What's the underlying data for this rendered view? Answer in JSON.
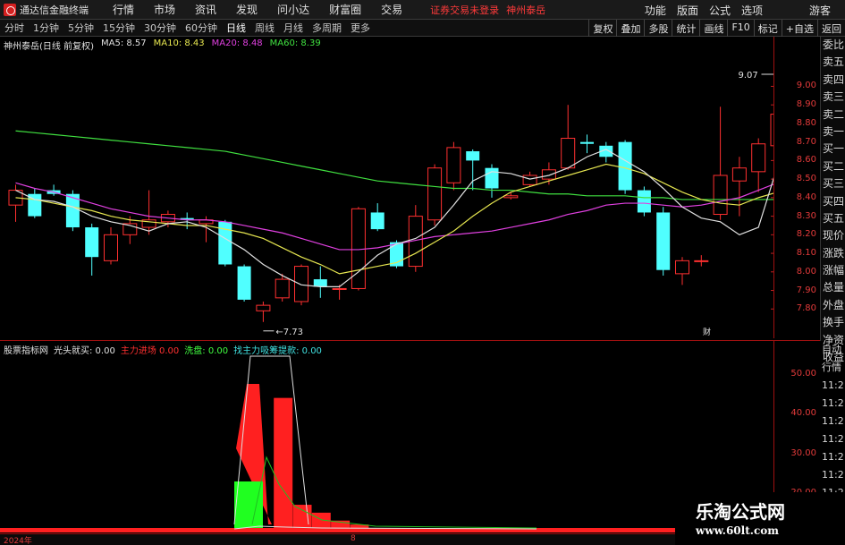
{
  "titlebar": {
    "app_title": "通达信金融终端",
    "menu": [
      "行情",
      "市场",
      "资讯",
      "发现",
      "问小达",
      "财富圈",
      "交易"
    ],
    "notice": "证券交易未登录",
    "stock_tag": "神州泰岳",
    "right_menu": [
      "功能",
      "版面",
      "公式",
      "选项"
    ],
    "guest": "游客"
  },
  "periodbar": {
    "periods": [
      "分时",
      "1分钟",
      "5分钟",
      "15分钟",
      "30分钟",
      "60分钟",
      "日线",
      "周线",
      "月线",
      "多周期",
      "更多"
    ],
    "active": "日线",
    "tools": [
      "复权",
      "叠加",
      "多股",
      "统计",
      "画线",
      "F10",
      "标记",
      "+自选",
      "返回"
    ]
  },
  "main_legend": {
    "stock": "神州泰岳(日线 前复权)",
    "ma5": "MA5: 8.57",
    "ma10": "MA10: 8.43",
    "ma20": "MA20: 8.48",
    "ma60": "MA60: 8.39"
  },
  "side_labels": [
    "委比",
    "卖五",
    "卖四",
    "卖三",
    "卖二",
    "卖一",
    "买一",
    "买二",
    "买三",
    "买四",
    "买五",
    "现价",
    "涨跌",
    "涨幅",
    "总量",
    "外盘",
    "换手",
    "净资",
    "收益"
  ],
  "sub_side_labels": [
    "自动",
    "行情",
    "11:2",
    "11:2",
    "11:2",
    "11:2",
    "11:2",
    "11:2",
    "11:2"
  ],
  "annotations": {
    "high": "9.07",
    "low": "7.73",
    "fin": "财"
  },
  "sub_legend": {
    "name": "股票指标网",
    "a": "光头就买: 0.00",
    "b": "主力进场 0.00",
    "c": "洗盘: 0.00",
    "d": "找主力吸筹提款: 0.00"
  },
  "bottombar": {
    "year": "2024年",
    "month": "8"
  },
  "watermark": {
    "line1": "乐淘公式网",
    "line2": "www.60lt.com"
  },
  "colors": {
    "up": "#ff3030",
    "down": "#50ffff",
    "axis": "#e23a3a",
    "ma5": "#e0e0e0",
    "ma10": "#e6e650",
    "ma20": "#e040e0",
    "ma60": "#40e040"
  },
  "chart_data": [
    {
      "type": "candlestick",
      "title": "神州泰岳(日线 前复权)",
      "ylim": [
        7.7,
        9.2
      ],
      "yticks": [
        9.0,
        8.9,
        8.8,
        8.7,
        8.6,
        8.5,
        8.4,
        8.3,
        8.2,
        8.1,
        8.0,
        7.9,
        7.8
      ],
      "candles": [
        {
          "o": 8.36,
          "c": 8.44,
          "h": 8.47,
          "l": 8.27
        },
        {
          "o": 8.42,
          "c": 8.3,
          "h": 8.45,
          "l": 8.29
        },
        {
          "o": 8.44,
          "c": 8.42,
          "h": 8.47,
          "l": 8.41
        },
        {
          "o": 8.42,
          "c": 8.24,
          "h": 8.44,
          "l": 8.22
        },
        {
          "o": 8.24,
          "c": 8.08,
          "h": 8.26,
          "l": 7.98
        },
        {
          "o": 8.06,
          "c": 8.2,
          "h": 8.24,
          "l": 8.04
        },
        {
          "o": 8.2,
          "c": 8.26,
          "h": 8.3,
          "l": 8.15
        },
        {
          "o": 8.24,
          "c": 8.28,
          "h": 8.44,
          "l": 8.2
        },
        {
          "o": 8.27,
          "c": 8.31,
          "h": 8.33,
          "l": 8.24
        },
        {
          "o": 8.29,
          "c": 8.28,
          "h": 8.32,
          "l": 8.23
        },
        {
          "o": 8.26,
          "c": 8.28,
          "h": 8.3,
          "l": 8.16
        },
        {
          "o": 8.27,
          "c": 8.04,
          "h": 8.28,
          "l": 8.03
        },
        {
          "o": 8.03,
          "c": 7.85,
          "h": 8.04,
          "l": 7.84
        },
        {
          "o": 7.79,
          "c": 7.82,
          "h": 7.84,
          "l": 7.73
        },
        {
          "o": 7.86,
          "c": 7.96,
          "h": 7.99,
          "l": 7.84
        },
        {
          "o": 7.84,
          "c": 8.03,
          "h": 8.04,
          "l": 7.82
        },
        {
          "o": 7.96,
          "c": 7.92,
          "h": 8.03,
          "l": 7.86
        },
        {
          "o": 7.91,
          "c": 7.91,
          "h": 7.93,
          "l": 7.85
        },
        {
          "o": 7.91,
          "c": 8.34,
          "h": 8.35,
          "l": 7.9
        },
        {
          "o": 8.32,
          "c": 8.23,
          "h": 8.37,
          "l": 8.22
        },
        {
          "o": 8.16,
          "c": 8.03,
          "h": 8.17,
          "l": 8.02
        },
        {
          "o": 8.03,
          "c": 8.3,
          "h": 8.36,
          "l": 8.0
        },
        {
          "o": 8.28,
          "c": 8.56,
          "h": 8.58,
          "l": 8.25
        },
        {
          "o": 8.48,
          "c": 8.67,
          "h": 8.7,
          "l": 8.44
        },
        {
          "o": 8.65,
          "c": 8.6,
          "h": 8.66,
          "l": 8.44
        },
        {
          "o": 8.56,
          "c": 8.45,
          "h": 8.58,
          "l": 8.4
        },
        {
          "o": 8.4,
          "c": 8.41,
          "h": 8.43,
          "l": 8.39
        },
        {
          "o": 8.47,
          "c": 8.52,
          "h": 8.54,
          "l": 8.46
        },
        {
          "o": 8.5,
          "c": 8.55,
          "h": 8.59,
          "l": 8.47
        },
        {
          "o": 8.56,
          "c": 8.72,
          "h": 8.9,
          "l": 8.55
        },
        {
          "o": 8.7,
          "c": 8.69,
          "h": 8.74,
          "l": 8.64
        },
        {
          "o": 8.68,
          "c": 8.62,
          "h": 8.7,
          "l": 8.59
        },
        {
          "o": 8.7,
          "c": 8.44,
          "h": 8.71,
          "l": 8.42
        },
        {
          "o": 8.44,
          "c": 8.32,
          "h": 8.46,
          "l": 8.3
        },
        {
          "o": 8.32,
          "c": 8.01,
          "h": 8.35,
          "l": 7.98
        },
        {
          "o": 7.99,
          "c": 8.06,
          "h": 8.08,
          "l": 7.93
        },
        {
          "o": 8.06,
          "c": 8.06,
          "h": 8.09,
          "l": 8.03
        },
        {
          "o": 8.31,
          "c": 8.52,
          "h": 8.89,
          "l": 8.28
        },
        {
          "o": 8.49,
          "c": 8.56,
          "h": 8.62,
          "l": 8.3
        },
        {
          "o": 8.54,
          "c": 8.69,
          "h": 8.72,
          "l": 8.43
        },
        {
          "o": 8.68,
          "c": 8.85,
          "h": 9.07,
          "l": 8.64
        }
      ],
      "ma5": [
        8.44,
        8.39,
        8.38,
        8.35,
        8.3,
        8.27,
        8.25,
        8.22,
        8.26,
        8.27,
        8.24,
        8.18,
        8.12,
        8.04,
        7.98,
        7.93,
        7.92,
        7.92,
        8.0,
        8.09,
        8.15,
        8.18,
        8.24,
        8.36,
        8.49,
        8.54,
        8.53,
        8.5,
        8.52,
        8.56,
        8.62,
        8.66,
        8.6,
        8.54,
        8.45,
        8.35,
        8.29,
        8.27,
        8.2,
        8.24,
        8.57
      ],
      "ma10": [
        8.4,
        8.39,
        8.37,
        8.35,
        8.33,
        8.3,
        8.28,
        8.27,
        8.26,
        8.25,
        8.25,
        8.23,
        8.21,
        8.18,
        8.13,
        8.08,
        8.04,
        7.99,
        8.01,
        8.03,
        8.05,
        8.1,
        8.16,
        8.22,
        8.3,
        8.37,
        8.43,
        8.46,
        8.49,
        8.52,
        8.55,
        8.58,
        8.56,
        8.53,
        8.48,
        8.43,
        8.39,
        8.37,
        8.36,
        8.4,
        8.43
      ],
      "ma20": [
        8.48,
        8.45,
        8.43,
        8.4,
        8.37,
        8.34,
        8.32,
        8.3,
        8.29,
        8.28,
        8.28,
        8.27,
        8.25,
        8.23,
        8.21,
        8.18,
        8.15,
        8.12,
        8.12,
        8.13,
        8.15,
        8.17,
        8.19,
        8.2,
        8.21,
        8.22,
        8.24,
        8.26,
        8.28,
        8.31,
        8.33,
        8.36,
        8.37,
        8.37,
        8.36,
        8.35,
        8.36,
        8.38,
        8.4,
        8.44,
        8.48
      ],
      "ma60": [
        8.76,
        8.75,
        8.74,
        8.73,
        8.72,
        8.71,
        8.7,
        8.69,
        8.68,
        8.67,
        8.66,
        8.65,
        8.63,
        8.61,
        8.59,
        8.57,
        8.55,
        8.53,
        8.51,
        8.49,
        8.48,
        8.47,
        8.46,
        8.45,
        8.45,
        8.44,
        8.44,
        8.43,
        8.42,
        8.42,
        8.41,
        8.41,
        8.41,
        8.4,
        8.4,
        8.39,
        8.39,
        8.39,
        8.39,
        8.39,
        8.39
      ]
    },
    {
      "type": "bar",
      "title": "股票指标网",
      "ylim": [
        10,
        55
      ],
      "yticks": [
        50.0,
        40.0,
        30.0,
        20.0
      ],
      "series": [
        {
          "name": "主力进场",
          "values": [
            0,
            0,
            0,
            0,
            0,
            0,
            0,
            0,
            0,
            0,
            0,
            0,
            0,
            0,
            44,
            17,
            15,
            13,
            12,
            11,
            11,
            10.5,
            10,
            10,
            10,
            10,
            10,
            10,
            10,
            10,
            10,
            10,
            10,
            10,
            10,
            10,
            10,
            10,
            10,
            10,
            10
          ]
        },
        {
          "name": "洗盘",
          "values": [
            0,
            0,
            0,
            0,
            0,
            0,
            0,
            0,
            0,
            0,
            0,
            0,
            0,
            0,
            0,
            0,
            0,
            0,
            0,
            0,
            0,
            0,
            0,
            0,
            0,
            0,
            0,
            0,
            0,
            0,
            0,
            0,
            0,
            0,
            0,
            0,
            0,
            0,
            0,
            0,
            0
          ]
        }
      ]
    }
  ]
}
